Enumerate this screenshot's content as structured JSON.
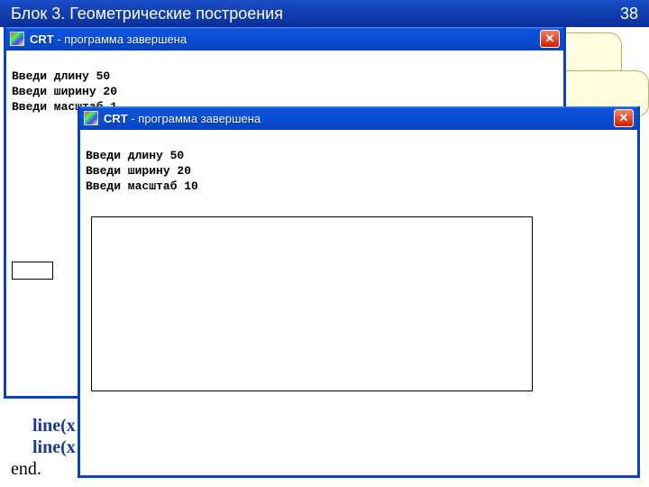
{
  "header": {
    "title": "Блок 3. Геометрические построения",
    "number": "38"
  },
  "window_back": {
    "title_app": "CRT",
    "title_suffix": "- программа завершена",
    "close_glyph": "✕",
    "console": {
      "line1": "Введи длину 50",
      "line2": "Введи ширину 20",
      "line3": "Введи масштаб 1"
    }
  },
  "window_front": {
    "title_app": "CRT",
    "title_suffix": "- программа завершена",
    "close_glyph": "✕",
    "console": {
      "line1": "Введи длину 50",
      "line2": "Введи ширину 20",
      "line3": "Введи масштаб 10"
    }
  },
  "code": {
    "line1": "line(x",
    "line2": "line(x",
    "line3": "end."
  }
}
